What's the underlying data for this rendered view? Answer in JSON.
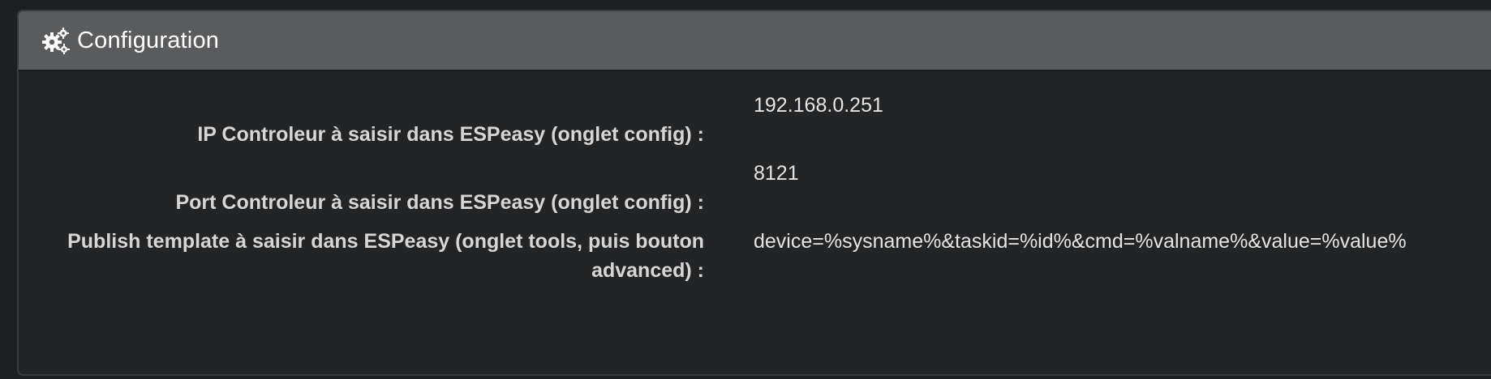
{
  "panel": {
    "title": "Configuration",
    "icon": "gears-icon"
  },
  "fields": [
    {
      "label": "IP Controleur à saisir dans ESPeasy (onglet config) :",
      "value": "192.168.0.251"
    },
    {
      "label": "Port Controleur à saisir dans ESPeasy (onglet config) :",
      "value": "8121"
    },
    {
      "label": "Publish template à saisir dans ESPeasy (onglet tools, puis bouton advanced) :",
      "value": "device=%sysname%&taskid=%id%&cmd=%valname%&value=%value%"
    }
  ],
  "colors": {
    "header_bg": "#5a5b5d",
    "body_bg": "#232426",
    "label_text": "#d6d6d6",
    "value_text": "#e4e4e4"
  }
}
